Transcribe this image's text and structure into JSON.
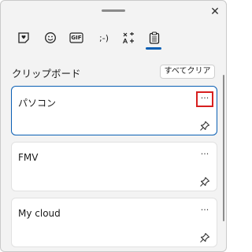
{
  "window": {
    "close_glyph": "✕",
    "close_icon": "close-icon"
  },
  "tabs": [
    {
      "icon": "sticker-heart-icon",
      "selected": false
    },
    {
      "icon": "emoji-smile-icon",
      "selected": false
    },
    {
      "icon": "gif-icon",
      "label": "GIF",
      "selected": false
    },
    {
      "icon": "kaomoji-icon",
      "label": ";-)",
      "selected": false
    },
    {
      "icon": "symbols-icon",
      "selected": false
    },
    {
      "icon": "clipboard-icon",
      "selected": true
    }
  ],
  "clipboard": {
    "title": "クリップボード",
    "clear_all_label": "すべてクリア",
    "items": [
      {
        "text": "パソコン",
        "more_label": "···",
        "pin_icon": "pin-icon",
        "selected": true,
        "highlight_more": true
      },
      {
        "text": "FMV",
        "more_label": "···",
        "pin_icon": "pin-icon",
        "selected": false,
        "highlight_more": false
      },
      {
        "text": "My cloud",
        "more_label": "···",
        "pin_icon": "pin-icon",
        "selected": false,
        "highlight_more": false
      }
    ]
  },
  "colors": {
    "accent": "#0a5fb4",
    "highlight_box": "#d71f1f",
    "panel_bg": "#f3f3f3",
    "card_bg": "#ffffff"
  }
}
